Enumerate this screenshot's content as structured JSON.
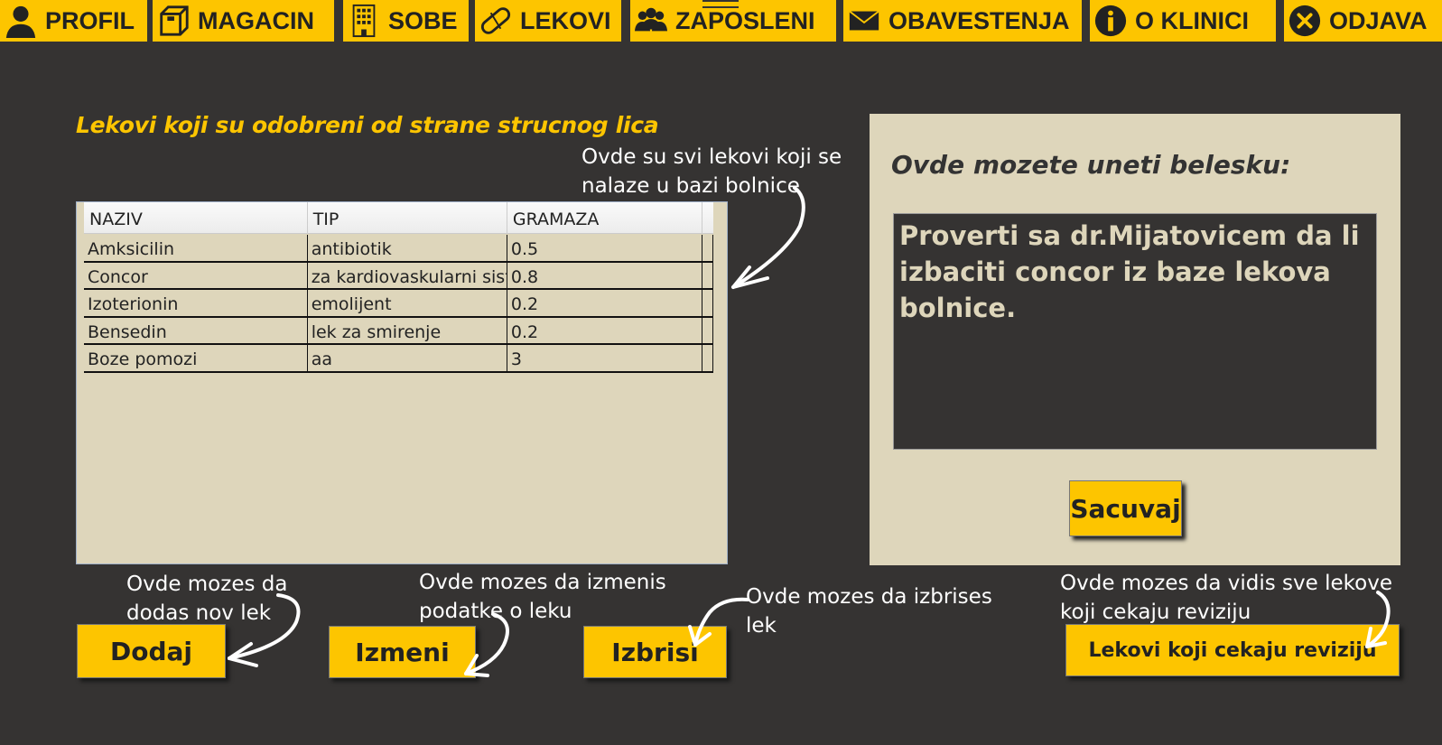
{
  "nav": {
    "items": [
      {
        "label": "PROFIL",
        "icon": "user-icon"
      },
      {
        "label": "MAGACIN",
        "icon": "box-icon"
      },
      {
        "label": "SOBE",
        "icon": "building-icon"
      },
      {
        "label": "LEKOVI",
        "icon": "pill-icon"
      },
      {
        "label": "ZAPOSLENI",
        "icon": "group-icon"
      },
      {
        "label": "OBAVESTENJA",
        "icon": "envelope-icon"
      },
      {
        "label": "O KLINICI",
        "icon": "info-icon"
      },
      {
        "label": "ODJAVA",
        "icon": "close-circle-icon"
      }
    ],
    "accent": "#fdc500"
  },
  "main": {
    "title": "Lekovi koji su odobreni od strane strucnog lica",
    "table": {
      "headers": [
        "NAZIV",
        "TIP",
        "GRAMAZA"
      ],
      "rows": [
        [
          "Amksicilin",
          "antibiotik",
          "0.5"
        ],
        [
          "Concor",
          "za kardiovaskularni sistem",
          "0.8"
        ],
        [
          "Izoterionin",
          "emolijent",
          "0.2"
        ],
        [
          "Bensedin",
          "lek za smirenje",
          "0.2"
        ],
        [
          "Boze pomozi",
          "aa",
          "3"
        ]
      ]
    },
    "buttons": {
      "add": "Dodaj",
      "edit": "Izmeni",
      "delete": "Izbrisi",
      "review": "Lekovi koji cekaju reviziju"
    }
  },
  "notes": {
    "title": "Ovde mozete uneti belesku:",
    "value": "Proverti sa dr.Mijatovicem da li izbaciti concor iz baze lekova bolnice.",
    "save": "Sacuvaj"
  },
  "annotations": {
    "table": [
      "Ovde su svi lekovi koji se",
      "nalaze u bazi bolnice"
    ],
    "add": [
      "Ovde mozes da",
      "dodas nov lek"
    ],
    "edit": [
      "Ovde mozes da izmenis",
      "podatke o leku"
    ],
    "delete": [
      "Ovde mozes da izbrises",
      "lek"
    ],
    "review": [
      "Ovde mozes da vidis sve lekove",
      "koji cekaju reviziju"
    ]
  },
  "colors": {
    "background": "#353332",
    "panel": "#ded6bb",
    "accent": "#fdc500"
  }
}
